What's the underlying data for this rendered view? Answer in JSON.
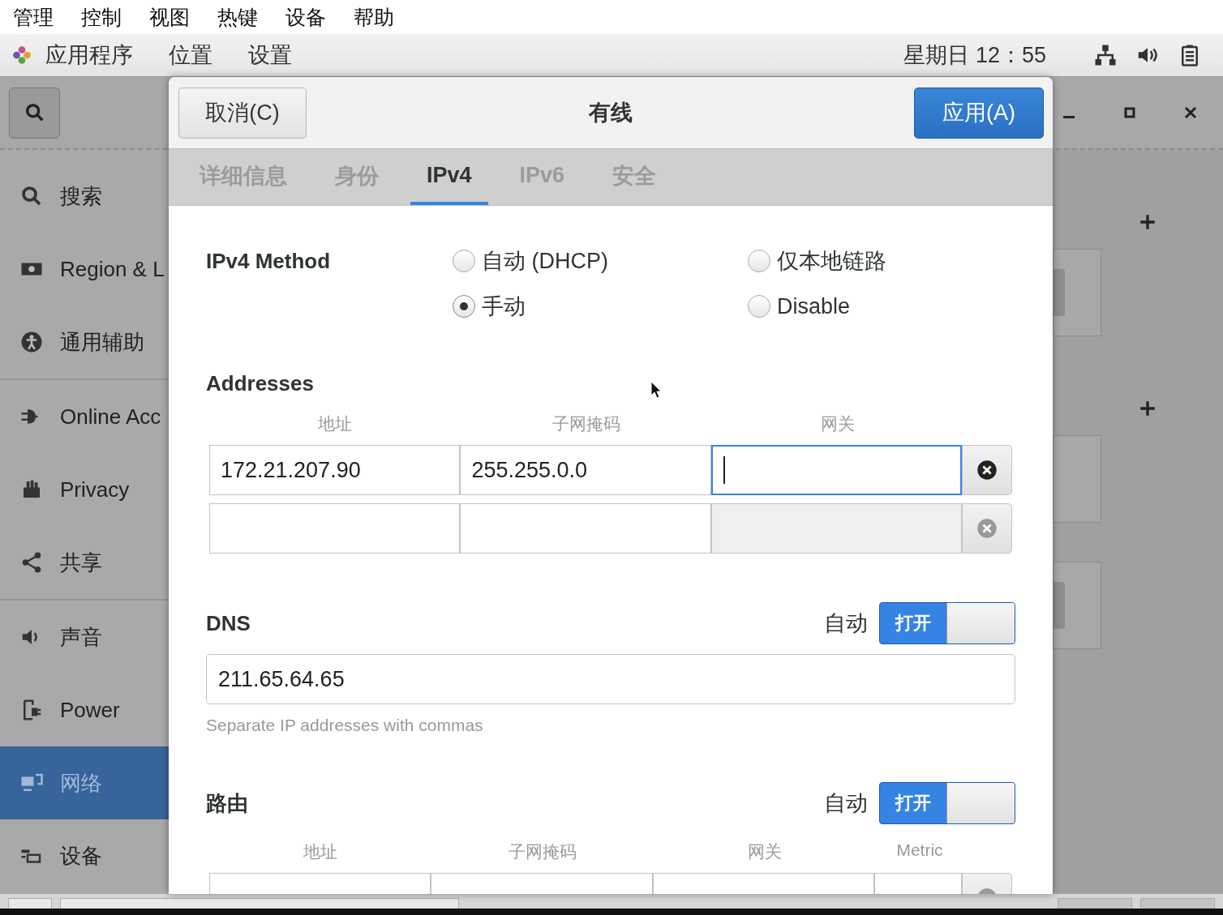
{
  "menu_bar": [
    "管理",
    "控制",
    "视图",
    "热键",
    "设备",
    "帮助"
  ],
  "top_bar": {
    "menus": [
      "应用程序",
      "位置",
      "设置"
    ],
    "clock": "星期日 12：55"
  },
  "sidebar": {
    "items": [
      {
        "kind": "search",
        "label": "搜索",
        "selected": false
      },
      {
        "kind": "region",
        "label": "Region & L",
        "selected": false
      },
      {
        "kind": "accessibility",
        "label": "通用辅助",
        "selected": false
      },
      {
        "kind": "online",
        "label": "Online Acc",
        "selected": false
      },
      {
        "kind": "privacy",
        "label": "Privacy",
        "selected": false
      },
      {
        "kind": "share",
        "label": "共享",
        "selected": false
      },
      {
        "kind": "sound",
        "label": "声音",
        "selected": false
      },
      {
        "kind": "power",
        "label": "Power",
        "selected": false
      },
      {
        "kind": "network",
        "label": "网络",
        "selected": true
      },
      {
        "kind": "devices",
        "label": "设备",
        "selected": false
      }
    ]
  },
  "dialog": {
    "cancel": "取消(C)",
    "title": "有线",
    "apply": "应用(A)",
    "tabs": [
      {
        "label": "详细信息",
        "selected": false
      },
      {
        "label": "身份",
        "selected": false
      },
      {
        "label": "IPv4",
        "selected": true
      },
      {
        "label": "IPv6",
        "selected": false
      },
      {
        "label": "安全",
        "selected": false
      }
    ],
    "method": {
      "label": "IPv4 Method",
      "options": [
        {
          "label": "自动 (DHCP)",
          "selected": false
        },
        {
          "label": "仅本地链路",
          "selected": false
        },
        {
          "label": "手动",
          "selected": true
        },
        {
          "label": "Disable",
          "selected": false
        }
      ]
    },
    "addresses": {
      "title": "Addresses",
      "columns": [
        "地址",
        "子网掩码",
        "网关"
      ],
      "rows": [
        {
          "address": "172.21.207.90",
          "netmask": "255.255.0.0",
          "focused": true,
          "disabled": false
        },
        {
          "focused": false,
          "disabled": true
        }
      ]
    },
    "dns": {
      "title": "DNS",
      "auto_label": "自动",
      "switch": {
        "label": "打开",
        "on": true
      },
      "value": "211.65.64.65",
      "hint": "Separate IP addresses with commas"
    },
    "routes": {
      "title": "路由",
      "auto_label": "自动",
      "switch": {
        "label": "打开",
        "on": true
      },
      "columns": [
        "地址",
        "子网掩码",
        "网关",
        "Metric"
      ],
      "rows": [
        {
          "disabled": true
        }
      ]
    }
  }
}
